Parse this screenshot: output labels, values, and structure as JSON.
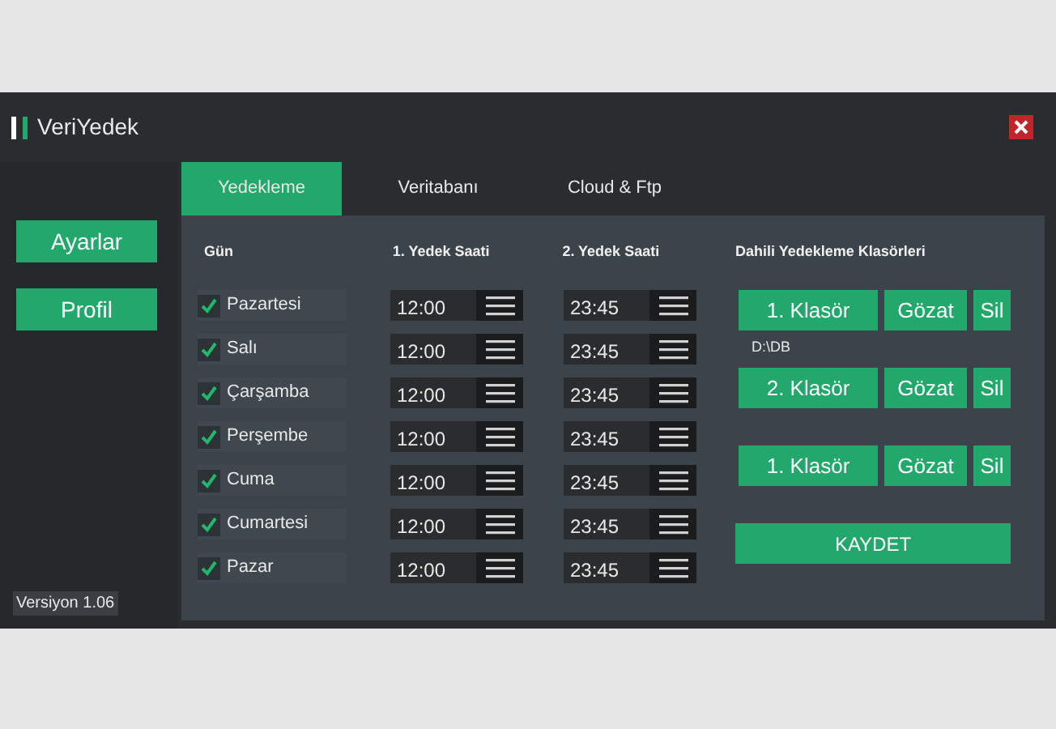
{
  "window": {
    "title": "VeriYedek"
  },
  "sidebar": {
    "items": [
      {
        "label": "Ayarlar"
      },
      {
        "label": "Profil"
      }
    ],
    "version": "Versiyon 1.06"
  },
  "tabs": [
    {
      "label": "Yedekleme",
      "selected": true
    },
    {
      "label": "Veritabanı",
      "selected": false
    },
    {
      "label": "Cloud & Ftp",
      "selected": false
    }
  ],
  "schedule": {
    "columns": [
      "Gün",
      "1. Yedek Saati",
      "2. Yedek Saati"
    ],
    "days": [
      {
        "name": "Pazartesi",
        "checked": true,
        "time_1": "12:00",
        "time_2": "23:45"
      },
      {
        "name": "Salı",
        "checked": true,
        "time_1": "12:00",
        "time_2": "23:45"
      },
      {
        "name": "Çarşamba",
        "checked": true,
        "time_1": "12:00",
        "time_2": "23:45"
      },
      {
        "name": "Perşembe",
        "checked": true,
        "time_1": "12:00",
        "time_2": "23:45"
      },
      {
        "name": "Cuma",
        "checked": true,
        "time_1": "12:00",
        "time_2": "23:45"
      },
      {
        "name": "Cumartesi",
        "checked": true,
        "time_1": "12:00",
        "time_2": "23:45"
      },
      {
        "name": "Pazar",
        "checked": true,
        "time_1": "12:00",
        "time_2": "23:45"
      }
    ]
  },
  "folders": {
    "title": "Dahili Yedekleme Klasörleri",
    "items": [
      {
        "label": "1. Klasör",
        "browse": "Gözat",
        "delete": "Sil",
        "path": "D:\\DB"
      },
      {
        "label": "2. Klasör",
        "browse": "Gözat",
        "delete": "Sil"
      },
      {
        "label": "1. Klasör",
        "browse": "Gözat",
        "delete": "Sil"
      }
    ]
  },
  "save_button": "KAYDET"
}
